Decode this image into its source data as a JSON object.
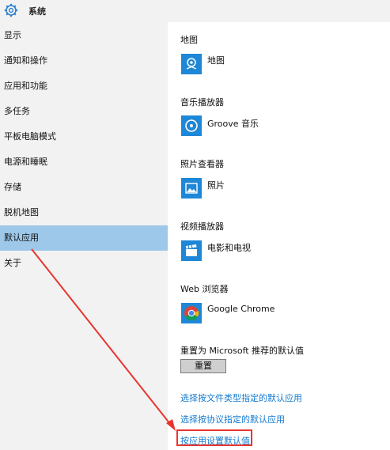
{
  "window": {
    "title": "系统",
    "icon": "gear-icon"
  },
  "sidebar": {
    "items": [
      {
        "label": "显示",
        "selected": false
      },
      {
        "label": "通知和操作",
        "selected": false
      },
      {
        "label": "应用和功能",
        "selected": false
      },
      {
        "label": "多任务",
        "selected": false
      },
      {
        "label": "平板电脑模式",
        "selected": false
      },
      {
        "label": "电源和睡眠",
        "selected": false
      },
      {
        "label": "存储",
        "selected": false
      },
      {
        "label": "脱机地图",
        "selected": false
      },
      {
        "label": "默认应用",
        "selected": true
      },
      {
        "label": "关于",
        "selected": false
      }
    ]
  },
  "main": {
    "sections": [
      {
        "title": "地图",
        "app": "地图",
        "icon": "maps-icon"
      },
      {
        "title": "音乐播放器",
        "app": "Groove 音乐",
        "icon": "groove-music-icon"
      },
      {
        "title": "照片查看器",
        "app": "照片",
        "icon": "photos-icon"
      },
      {
        "title": "视频播放器",
        "app": "电影和电视",
        "icon": "movies-tv-icon"
      },
      {
        "title": "Web 浏览器",
        "app": "Google Chrome",
        "icon": "chrome-icon"
      }
    ],
    "reset": {
      "label": "重置为 Microsoft 推荐的默认值",
      "button": "重置"
    },
    "links": [
      "选择按文件类型指定的默认应用",
      "选择按协议指定的默认应用",
      "按应用设置默认值"
    ]
  },
  "colors": {
    "selected_bg": "#9ec8ea",
    "tile_blue": "#1e87d7",
    "link": "#1479d0",
    "annotation_red": "#e8352f"
  }
}
